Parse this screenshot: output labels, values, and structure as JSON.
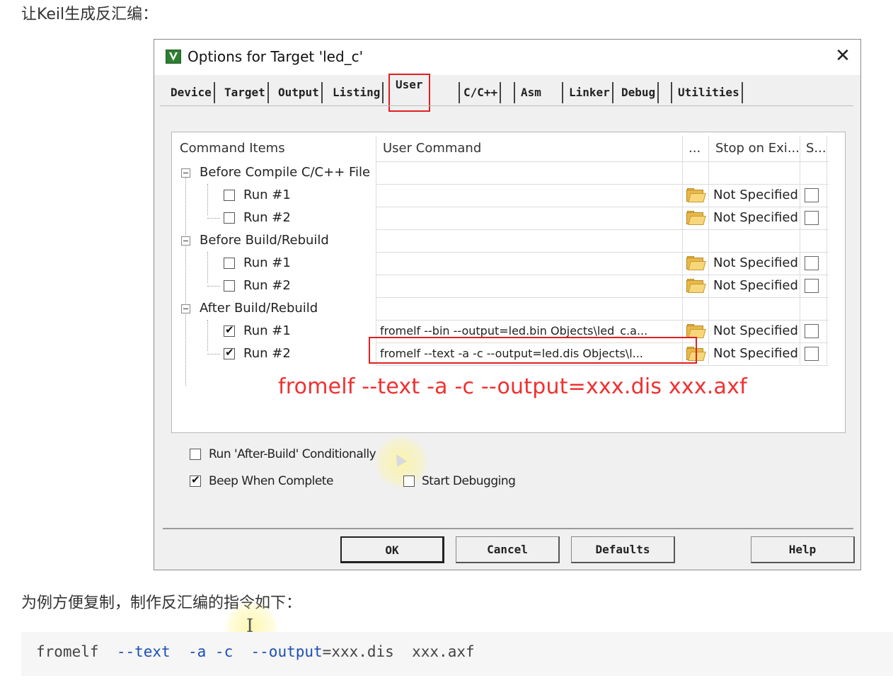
{
  "article": {
    "heading": "让Keil生成反汇编：",
    "subheading": "为例方便复制，制作反汇编的指令如下："
  },
  "dialog": {
    "title": "Options for Target 'led_c'",
    "close": "✕",
    "tabs": [
      "Device",
      "Target",
      "Output",
      "Listing",
      "User",
      "C/C++",
      "Asm",
      "Linker",
      "Debug",
      "Utilities"
    ],
    "active_tab": "User",
    "grid": {
      "headers": {
        "items": "Command Items",
        "command": "User Command",
        "browse": "...",
        "stop": "Stop on Exi...",
        "s": "S..."
      },
      "groups": [
        {
          "label": "Before Compile C/C++ File",
          "runs": [
            {
              "label": "Run #1",
              "checked": false,
              "command": "",
              "stop": "Not Specified"
            },
            {
              "label": "Run #2",
              "checked": false,
              "command": "",
              "stop": "Not Specified"
            }
          ]
        },
        {
          "label": "Before Build/Rebuild",
          "runs": [
            {
              "label": "Run #1",
              "checked": false,
              "command": "",
              "stop": "Not Specified"
            },
            {
              "label": "Run #2",
              "checked": false,
              "command": "",
              "stop": "Not Specified"
            }
          ]
        },
        {
          "label": "After Build/Rebuild",
          "runs": [
            {
              "label": "Run #1",
              "checked": true,
              "command": "fromelf --bin --output=led.bin Objects\\led_c.a...",
              "stop": "Not Specified"
            },
            {
              "label": "Run #2",
              "checked": true,
              "command": "fromelf --text -a -c --output=led.dis Objects\\l...",
              "stop": "Not Specified"
            }
          ]
        }
      ],
      "annotation": "fromelf  --text  -a -c  --output=xxx.dis  xxx.axf"
    },
    "options": {
      "run_after_build": {
        "label": "Run 'After-Build' Conditionally",
        "checked": false
      },
      "beep": {
        "label": "Beep When Complete",
        "checked": true
      },
      "start_debugging": {
        "label": "Start Debugging",
        "checked": false
      }
    },
    "buttons": {
      "ok": "OK",
      "cancel": "Cancel",
      "defaults": "Defaults",
      "help": "Help"
    }
  },
  "code": {
    "cmd": "fromelf",
    "opt_text": "--text",
    "opt_a": "-a",
    "opt_c": "-c",
    "opt_output": "--output",
    "eq_value": "=xxx.dis",
    "input": "xxx.axf"
  },
  "colors": {
    "annotation_red": "#f03030",
    "highlight_box": "#e02020",
    "code_option_blue": "#1a4fb5"
  }
}
